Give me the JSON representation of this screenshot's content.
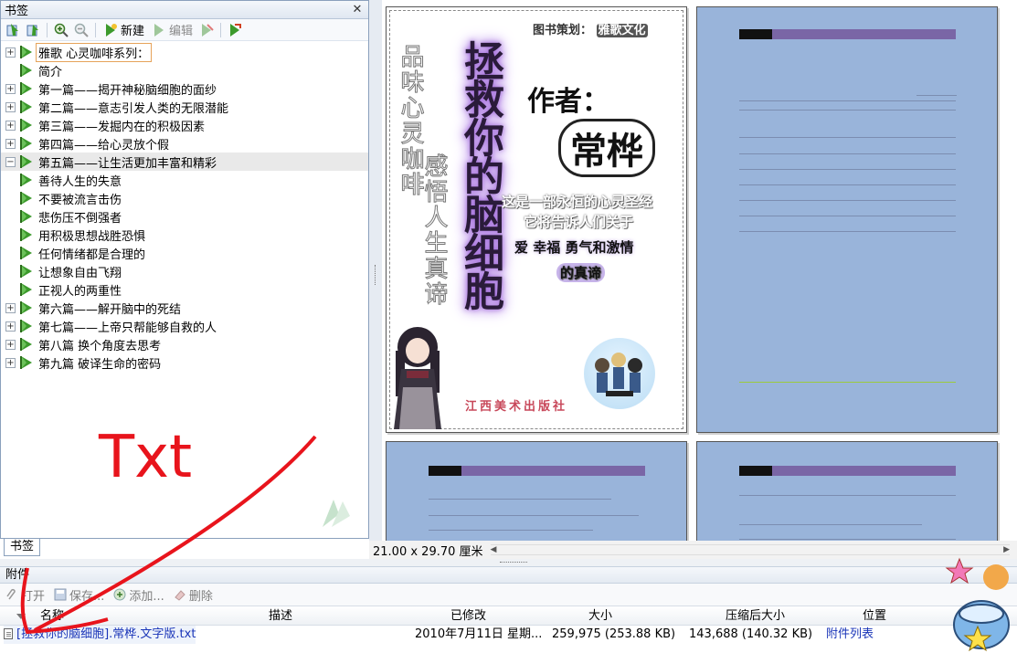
{
  "bookmarks_panel": {
    "title": "书签",
    "close_symbol": "✕",
    "toolbar": {
      "new_label": "新建",
      "edit_label": "编辑"
    },
    "items": [
      {
        "label": "雅歌  心灵咖啡系列：",
        "expander": "+",
        "level": 0
      },
      {
        "label": "简介",
        "expander": "",
        "level": 0
      },
      {
        "label": "第一篇——揭开神秘脑细胞的面纱",
        "expander": "+",
        "level": 0
      },
      {
        "label": "第二篇——意志引发人类的无限潜能",
        "expander": "+",
        "level": 0
      },
      {
        "label": "第三篇——发掘内在的积极因素",
        "expander": "+",
        "level": 0
      },
      {
        "label": "第四篇——给心灵放个假",
        "expander": "+",
        "level": 0
      },
      {
        "label": "第五篇——让生活更加丰富和精彩",
        "expander": "−",
        "level": 0
      },
      {
        "label": "善待人生的失意",
        "expander": "",
        "level": 1
      },
      {
        "label": "不要被流言击伤",
        "expander": "",
        "level": 1
      },
      {
        "label": "悲伤压不倒强者",
        "expander": "",
        "level": 1
      },
      {
        "label": "用积极思想战胜恐惧",
        "expander": "",
        "level": 1
      },
      {
        "label": "任何情绪都是合理的",
        "expander": "",
        "level": 1
      },
      {
        "label": "让想象自由飞翔",
        "expander": "",
        "level": 1
      },
      {
        "label": "正视人的两重性",
        "expander": "",
        "level": 1
      },
      {
        "label": "第六篇——解开脑中的死结",
        "expander": "+",
        "level": 0
      },
      {
        "label": "第七篇——上帝只帮能够自救的人",
        "expander": "+",
        "level": 0
      },
      {
        "label": "第八篇  换个角度去思考",
        "expander": "+",
        "level": 0
      },
      {
        "label": "第九篇  破译生命的密码",
        "expander": "+",
        "level": 0
      }
    ],
    "tab_label": "书签"
  },
  "document": {
    "page_size": "21.00 x 29.70 厘米",
    "cover": {
      "planner": "图书策划：",
      "planner_name": "雅歌文化",
      "side_text_1": "品味心灵咖啡",
      "side_text_2": "感悟人生真谛",
      "title": "拯救你的脑细胞",
      "author_label": "作者：",
      "author": "常桦",
      "line1": "这是一部永恒的心灵圣经",
      "line2": "它将告诉人们关于",
      "line3": "爱  幸福  勇气和激情",
      "line4": "的真谛",
      "publisher": "江西美术出版社"
    }
  },
  "attachments_panel": {
    "title": "附件",
    "toolbar": {
      "open_label": "打开",
      "save_label": "保存...",
      "add_label": "添加...",
      "delete_label": "删除"
    },
    "columns": {
      "name": "名称",
      "description": "描述",
      "modified": "已修改",
      "size": "大小",
      "compressed_size": "压缩后大小",
      "location": "位置"
    },
    "rows": [
      {
        "name": "[拯救你的脑细胞].常桦.文字版.txt",
        "description": "",
        "modified": "2010年7月11日 星期...",
        "size": "259,975 (253.88 KB)",
        "compressed_size": "143,688 (140.32 KB)",
        "location": "附件列表"
      }
    ]
  },
  "annotation": {
    "text": "Txt",
    "color": "#e8141c"
  },
  "colors": {
    "accent": "#1a35b8",
    "page_blue": "#99b4da",
    "bookmark_green": "#3c9a2c"
  }
}
